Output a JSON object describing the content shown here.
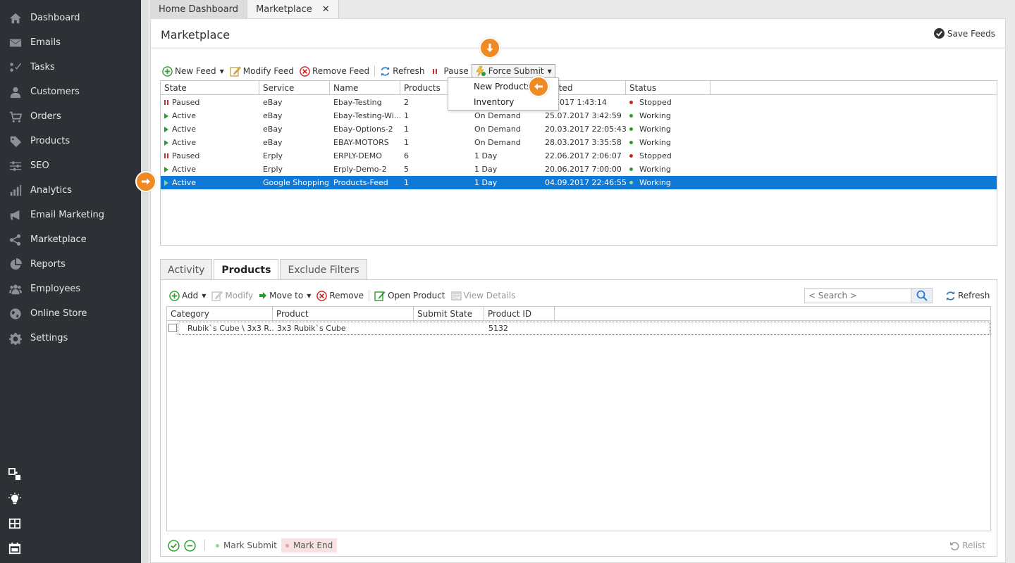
{
  "sidebar": {
    "items": [
      {
        "label": "Dashboard",
        "icon": "home-icon"
      },
      {
        "label": "Emails",
        "icon": "envelope-icon"
      },
      {
        "label": "Tasks",
        "icon": "tasks-icon"
      },
      {
        "label": "Customers",
        "icon": "user-icon"
      },
      {
        "label": "Orders",
        "icon": "cart-icon"
      },
      {
        "label": "Products",
        "icon": "tag-icon"
      },
      {
        "label": "SEO",
        "icon": "sliders-icon"
      },
      {
        "label": "Analytics",
        "icon": "bar-chart-icon"
      },
      {
        "label": "Email Marketing",
        "icon": "megaphone-icon"
      },
      {
        "label": "Marketplace",
        "icon": "share-icon"
      },
      {
        "label": "Reports",
        "icon": "pie-chart-icon"
      },
      {
        "label": "Employees",
        "icon": "users-icon"
      },
      {
        "label": "Online Store",
        "icon": "globe-icon"
      },
      {
        "label": "Settings",
        "icon": "gear-icon"
      }
    ],
    "bottom_icons": [
      "windows-icon",
      "lightbulb-icon",
      "layout-icon",
      "calendar-icon"
    ]
  },
  "tabs": {
    "home": "Home Dashboard",
    "marketplace": "Marketplace",
    "close": "✕"
  },
  "page": {
    "title": "Marketplace",
    "save_feeds": "Save Feeds"
  },
  "feed_toolbar": {
    "new_feed": "New Feed",
    "modify_feed": "Modify Feed",
    "remove_feed": "Remove Feed",
    "refresh": "Refresh",
    "pause": "Pause",
    "force_submit": "Force Submit"
  },
  "force_submit_menu": {
    "new_products": "New Products",
    "inventory": "Inventory"
  },
  "feeds_table": {
    "columns": [
      "State",
      "Service",
      "Name",
      "Products",
      "",
      "Submitted",
      "Status"
    ],
    "submitted_header_visible": "mitted",
    "rows": [
      {
        "state": "Paused",
        "service": "eBay",
        "name": "Ebay-Testing",
        "products": "2",
        "schedule": "",
        "submitted": ".3.2017 1:43:14",
        "status": "Stopped"
      },
      {
        "state": "Active",
        "service": "eBay",
        "name": "Ebay-Testing-Wi...",
        "products": "1",
        "schedule": "On Demand",
        "submitted": "25.07.2017 3:42:59",
        "status": "Working"
      },
      {
        "state": "Active",
        "service": "eBay",
        "name": "Ebay-Options-2",
        "products": "1",
        "schedule": "On Demand",
        "submitted": "20.03.2017 22:05:43",
        "status": "Working"
      },
      {
        "state": "Active",
        "service": "eBay",
        "name": "EBAY-MOTORS",
        "products": "1",
        "schedule": "On Demand",
        "submitted": "28.03.2017 3:35:58",
        "status": "Working"
      },
      {
        "state": "Paused",
        "service": "Erply",
        "name": "ERPLY-DEMO",
        "products": "6",
        "schedule": "1 Day",
        "submitted": "22.06.2017 2:06:07",
        "status": "Stopped"
      },
      {
        "state": "Active",
        "service": "Erply",
        "name": "Erply-Demo-2",
        "products": "5",
        "schedule": "1 Day",
        "submitted": "20.06.2017 7:00:00",
        "status": "Working"
      },
      {
        "state": "Active",
        "service": "Google Shopping",
        "name": "Products-Feed",
        "products": "1",
        "schedule": "1 Day",
        "submitted": "04.09.2017 22:46:55",
        "status": "Working"
      }
    ]
  },
  "sub_tabs": {
    "activity": "Activity",
    "products": "Products",
    "exclude_filters": "Exclude Filters"
  },
  "products_toolbar": {
    "add": "Add",
    "modify": "Modify",
    "move_to": "Move to",
    "remove": "Remove",
    "open_product": "Open Product",
    "view_details": "View Details",
    "search_placeholder": "< Search >",
    "refresh": "Refresh"
  },
  "products_table": {
    "columns": [
      "Category",
      "Product",
      "Submit State",
      "Product ID"
    ],
    "rows": [
      {
        "category": "Rubik`s Cube \\ 3x3 R...",
        "product": "3x3 Rubik`s Cube",
        "submit_state": "",
        "product_id": "5132"
      }
    ]
  },
  "bottom_bar": {
    "mark_submit": "Mark Submit",
    "mark_end": "Mark End",
    "relist": "Relist"
  },
  "colors": {
    "sidebar_bg": "#2d3035",
    "selection": "#0e79d7",
    "callout": "#f08a24",
    "active_green": "#2a9d2a",
    "stopped_red": "#cc2222"
  }
}
